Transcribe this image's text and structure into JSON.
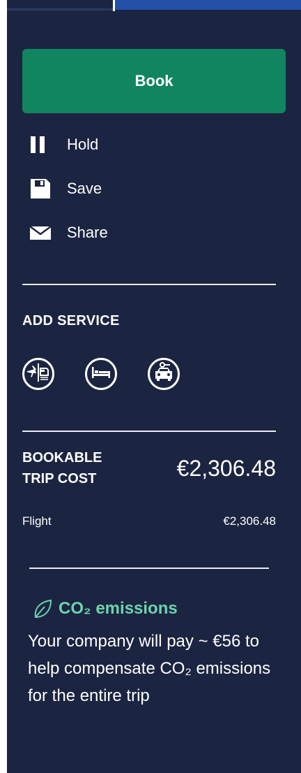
{
  "actions": {
    "book_label": "Book",
    "hold_label": "Hold",
    "save_label": "Save",
    "share_label": "Share"
  },
  "add_service": {
    "title": "ADD SERVICE",
    "services": [
      {
        "icon": "flight-train-icon"
      },
      {
        "icon": "hotel-bed-icon"
      },
      {
        "icon": "car-rental-icon"
      }
    ]
  },
  "cost": {
    "label_line1": "BOOKABLE",
    "label_line2": "TRIP COST",
    "total": "€2,306.48",
    "items": [
      {
        "label": "Flight",
        "amount": "€2,306.48"
      }
    ]
  },
  "co2": {
    "title": "CO₂ emissions",
    "text": "Your company will pay ~ €56 to help compensate CO₂ emissions for the entire trip"
  },
  "colors": {
    "panel_bg": "#1b2541",
    "book_button": "#11855f",
    "co2_accent": "#6fd3ad",
    "tab_active": "#2450a8"
  }
}
